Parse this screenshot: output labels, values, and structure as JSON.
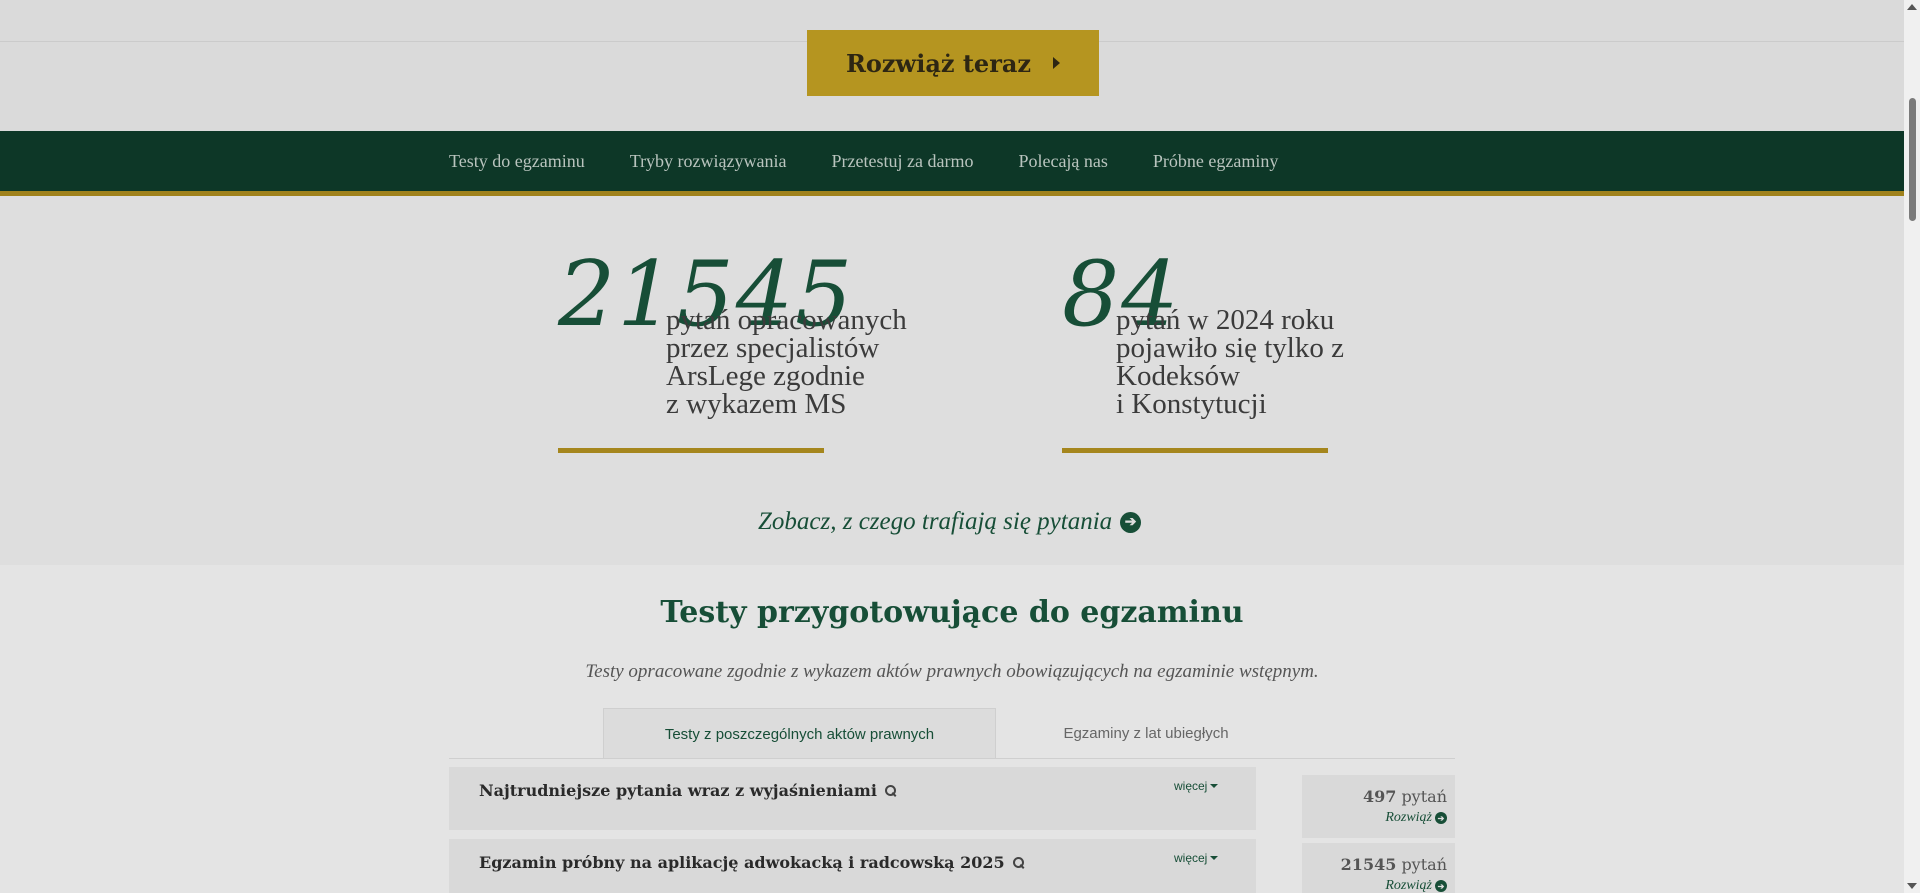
{
  "hero": {
    "cta_label": "Rozwiąż teraz",
    "cta_icon": "caret-right-icon"
  },
  "nav": {
    "items": [
      {
        "label": "Testy do egzaminu"
      },
      {
        "label": "Tryby rozwiązywania"
      },
      {
        "label": "Przetestuj za darmo"
      },
      {
        "label": "Polecają nas"
      },
      {
        "label": "Próbne egzaminy"
      }
    ]
  },
  "stats": [
    {
      "number": "21545",
      "text": "pytań opracowanych\nprzez specjalistów\nArsLege zgodnie\nz wykazem MS"
    },
    {
      "number": "84",
      "text": "pytań w 2024 roku\npojawiło się tylko z\nKodeksów\ni Konstytucji"
    }
  ],
  "see_link": {
    "label": "Zobacz, z czego trafiają się pytania",
    "icon": "circle-arrow-right-icon"
  },
  "tests": {
    "title": "Testy przygotowujące do egzaminu",
    "subtitle": "Testy opracowane zgodnie z wykazem aktów prawnych obowiązujących na egzaminie wstępnym.",
    "tabs": [
      {
        "label": "Testy z poszczególnych aktów prawnych",
        "active": true
      },
      {
        "label": "Egzaminy z lat ubiegłych",
        "active": false
      }
    ],
    "rows": [
      {
        "title": "Najtrudniejsze pytania wraz z wyjaśnieniami",
        "more": "więcej",
        "count": "497",
        "count_unit": "pytań",
        "action": "Rozwiąż"
      },
      {
        "title": "Egzamin próbny na aplikację adwokacką i radcowską 2025",
        "more": "więcej",
        "count": "21545",
        "count_unit": "pytań",
        "action": "Rozwiąż"
      }
    ]
  },
  "colors": {
    "brand_green": "#174e37",
    "nav_bg": "#0d3727",
    "gold": "#b59520"
  }
}
